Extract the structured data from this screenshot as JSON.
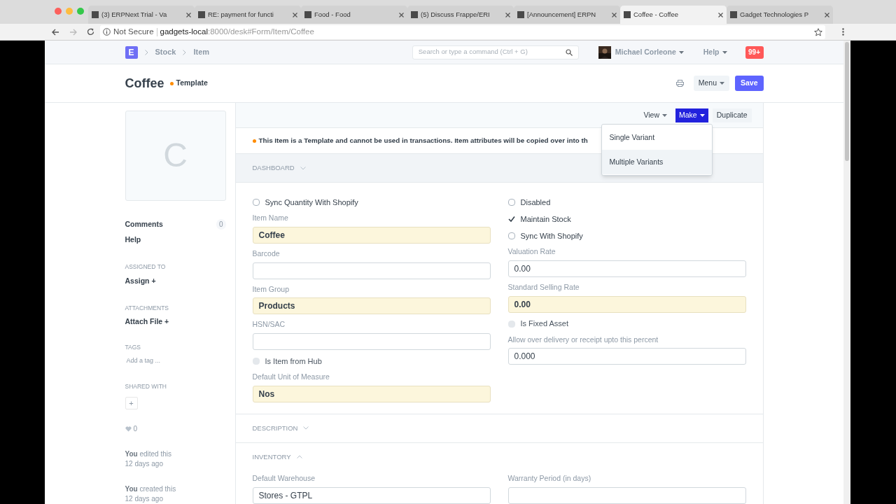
{
  "browser": {
    "tabs": [
      {
        "title": "(3) ERPNext Trial - Va",
        "selected": false
      },
      {
        "title": "RE: payment for functi",
        "selected": false
      },
      {
        "title": "Food - Food",
        "selected": false
      },
      {
        "title": "(5) Discuss Frappe/ERI",
        "selected": false
      },
      {
        "title": "[Announcement] ERPN",
        "selected": false
      },
      {
        "title": "Coffee - Coffee",
        "selected": true
      },
      {
        "title": "Gadget Technologies P",
        "selected": false
      }
    ],
    "address": {
      "security": "Not Secure",
      "host": "gadgets-local",
      "path": ":8000/desk#Form/Item/Coffee"
    }
  },
  "navbar": {
    "logo": "E",
    "breadcrumbs": [
      "Stock",
      "Item"
    ],
    "search": {
      "placeholder": "Search or type a command (Ctrl + G)"
    },
    "user": "Michael Corleone",
    "help": "Help",
    "notifications": "99+"
  },
  "page": {
    "title": "Coffee",
    "indicator": "Template",
    "menu": "Menu",
    "save": "Save"
  },
  "sidebar": {
    "image_initial": "C",
    "links": [
      {
        "label": "Comments",
        "count": "0"
      },
      {
        "label": "Help"
      }
    ],
    "assigned": {
      "heading": "ASSIGNED TO",
      "action": "Assign +"
    },
    "attachments": {
      "heading": "ATTACHMENTS",
      "action": "Attach File +"
    },
    "tags": {
      "heading": "TAGS",
      "placeholder": "Add a tag ..."
    },
    "shared": {
      "heading": "SHARED WITH",
      "add": "+"
    },
    "likes": "0",
    "timeline": [
      {
        "who": "You",
        "what": " edited this",
        "when": "12 days ago"
      },
      {
        "who": "You",
        "what": " created this",
        "when": "12 days ago"
      }
    ]
  },
  "toolbar": {
    "view": "View",
    "make": "Make",
    "duplicate": "Duplicate",
    "make_menu": [
      {
        "label": "Single Variant",
        "hovered": false
      },
      {
        "label": "Multiple Variants",
        "hovered": true
      }
    ]
  },
  "alert": "This Item is a Template and cannot be used in transactions. Item attributes will be copied over into th",
  "sections": [
    {
      "title": "DASHBOARD",
      "expanded": false,
      "shaded": true
    },
    {
      "shaded": false,
      "columns": [
        [
          {
            "kind": "check",
            "label": "Sync Quantity With Shopify",
            "checked": false,
            "read_only": false
          },
          {
            "kind": "input",
            "label": "Item Name",
            "value": "Coffee",
            "mandatory": true
          },
          {
            "kind": "input",
            "label": "Barcode",
            "mandatory": false
          },
          {
            "kind": "input",
            "label": "Item Group",
            "value": "Products",
            "mandatory": true
          },
          {
            "kind": "input",
            "label": "HSN/SAC",
            "mandatory": false
          },
          {
            "kind": "check",
            "label": "Is Item from Hub",
            "checked": false,
            "read_only": true
          },
          {
            "kind": "input",
            "label": "Default Unit of Measure",
            "value": "Nos",
            "mandatory": true
          }
        ],
        [
          {
            "kind": "check",
            "label": "Disabled",
            "checked": false,
            "read_only": false
          },
          {
            "kind": "check",
            "label": "Maintain Stock",
            "checked": true,
            "read_only": false
          },
          {
            "kind": "check",
            "label": "Sync With Shopify",
            "checked": false,
            "read_only": false
          },
          {
            "kind": "input",
            "label": "Valuation Rate",
            "value": "0.00",
            "mandatory": false
          },
          {
            "kind": "input",
            "label": "Standard Selling Rate",
            "value": "0.00",
            "mandatory": true
          },
          {
            "kind": "check",
            "label": "Is Fixed Asset",
            "checked": false,
            "read_only": true
          },
          {
            "kind": "input",
            "label": "Allow over delivery or receipt upto this percent",
            "value": "0.000",
            "mandatory": false
          }
        ]
      ]
    },
    {
      "title": "DESCRIPTION",
      "expanded": false,
      "shaded": false
    },
    {
      "title": "INVENTORY",
      "expanded": true,
      "shaded": false,
      "columns": [
        [
          {
            "kind": "input",
            "label": "Default Warehouse",
            "value": "Stores - GTPL",
            "mandatory": false
          }
        ],
        [
          {
            "kind": "input",
            "label": "Warranty Period (in days)",
            "mandatory": false
          }
        ]
      ]
    }
  ]
}
